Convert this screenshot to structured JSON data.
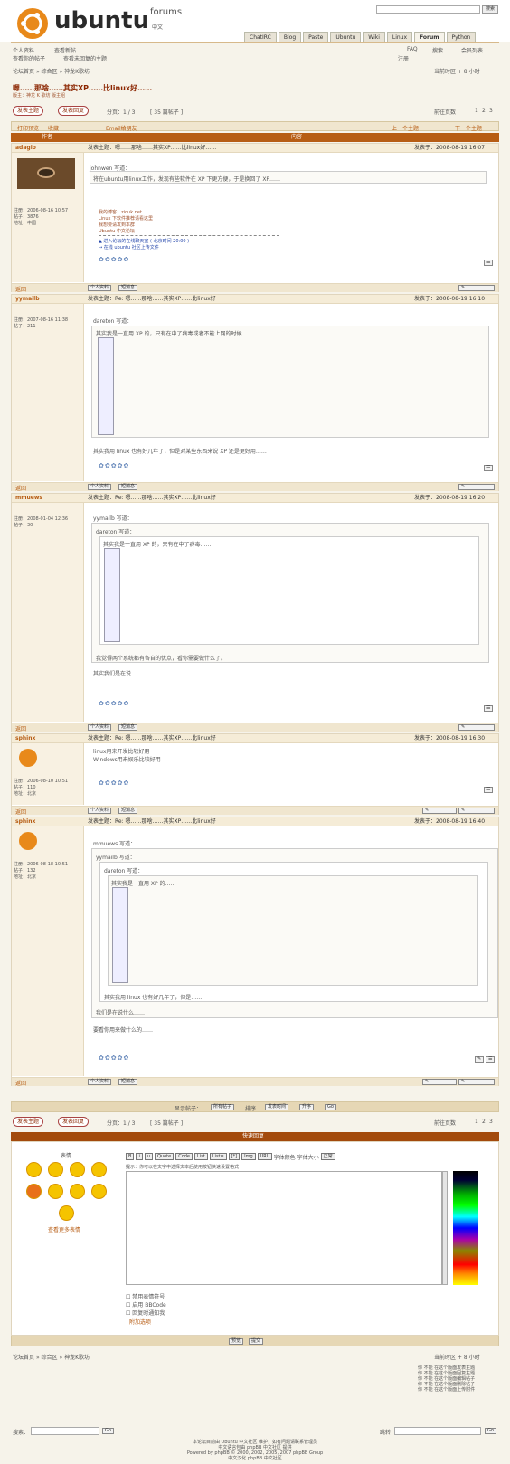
{
  "header": {
    "brand": "ubuntu",
    "forums": "forums",
    "lang": "中文",
    "search_btn": "搜索",
    "tabs": [
      "ChatIRC",
      "Blog",
      "Paste",
      "Ubuntu",
      "Wiki",
      "Linux",
      "Forum",
      "Python"
    ]
  },
  "userbar": {
    "faq": "FAQ",
    "search": "搜索",
    "members": "会员列表",
    "register": "注册",
    "profile": "个人资料",
    "pm": "查看新帖",
    "my_posts": "查看你的帖子",
    "unanswered": "查看未回复的主题"
  },
  "breadcrumb": {
    "home": "论坛首页",
    "sep1": "»",
    "area": "综合区",
    "sep2": "»",
    "forum": "神龙K歌坊",
    "time": "当前时区 + 8 小时"
  },
  "topic": {
    "title": "嗯……那啥……其实XP……比linux好……",
    "subtitle": "版主：神龙 K 歌坊 版主组"
  },
  "actions": {
    "new_topic": "发表主题",
    "reply": "发表回复",
    "pages": "分页：1 / 3",
    "posts": "[ 35 篇帖子 ]",
    "goto": "前往页数",
    "page1": "1",
    "page2": "2",
    "page3": "3"
  },
  "topicnav": {
    "print": "打印预览",
    "bookmark": "收藏",
    "email": "Email给朋友",
    "prev": "上一个主题",
    "next": "下一个主题"
  },
  "table_head": {
    "author": "作者",
    "content": "内容"
  },
  "posts": [
    {
      "author": "adagio",
      "meta_left": "注册：2006-08-16 10:57",
      "meta_left2": "帖子：3876",
      "meta_left3": "地址：中国",
      "subject": "发表主题：嗯……那啥……其实XP……比linux好……",
      "time": "发表于：2008-08-19 16:07",
      "body1": "johnwen 写道：",
      "body2": "将在ubuntu用linux工作，发现有些软件在 XP 下更方便，于是换回了 XP……",
      "sig1": "我的博客：ziouk.net",
      "sig2": "Linux 下软件推荐请看这里",
      "sig3": "我想要请发到本群",
      "sig4": "Ubuntu 中文论坛",
      "link1": "▲ 进入论坛的在线聊天室 ( 北京时间 20:00 )",
      "link2": "→ 在线 ubuntu 社区上传文件",
      "footer_l": "返回",
      "prof": "个人资料",
      "pm": "短消息"
    },
    {
      "author": "yymailb",
      "meta_left": "注册：2007-08-16 11:38",
      "meta_left2": "帖子：211",
      "subject": "发表主题：Re: 嗯……那啥……其实XP……比linux好",
      "time": "发表于：2008-08-19 16:10",
      "quote": "dareton 写道：",
      "quote2": "其实我是一直用 XP 的，只有在中了病毒或者不能上网的时候……",
      "body": "其实我用 linux 也有好几年了，但是对某些东西来说 XP 还是更好用……",
      "footer_l": "返回",
      "prof": "个人资料",
      "pm": "短消息"
    },
    {
      "author": "mmuews",
      "meta_left": "注册：2008-01-04 12:36",
      "meta_left2": "帖子：30",
      "subject": "发表主题：Re: 嗯……那啥……其实XP……比linux好",
      "time": "发表于：2008-08-19 16:20",
      "quote": "yymailb 写道：",
      "quote_inner": "dareton 写道：",
      "quote_inner2": "其实我是一直用 XP 的，只有在中了病毒……",
      "quote_tail": "我觉得两个系统都有各自的优点，看你需要做什么了。",
      "body": "其实我们是在说……",
      "footer_l": "返回",
      "prof": "个人资料",
      "pm": "短消息"
    },
    {
      "author": "sphinx",
      "meta_left": "注册：2006-08-10 10:51",
      "meta_left2": "帖子：110",
      "meta_left3": "地址：北京",
      "subject": "发表主题：Re: 嗯……那啥……其实XP……比linux好",
      "time": "发表于：2008-08-19 16:30",
      "body": "linux用来开发比较好用\nWindows用来娱乐比较好用",
      "footer_l": "返回",
      "prof": "个人资料",
      "pm": "短消息"
    },
    {
      "author": "sphinx",
      "meta_left": "注册：2006-08-18 10:51",
      "meta_left2": "帖子：132",
      "meta_left3": "地址：北京",
      "subject": "发表主题：Re: 嗯……那啥……其实XP……比linux好",
      "time": "发表于：2008-08-19 16:40",
      "quote": "mmuews 写道：",
      "quote2": "yymailb 写道：",
      "quote3": "dareton 写道：",
      "quote4": "其实我是一直用 XP 的……",
      "quote_tail": "其实我用 linux 也有好几年了，但是……",
      "quote_end": "我们是在说什么……",
      "body": "要看你用来做什么的……",
      "footer_l": "返回",
      "prof": "个人资料",
      "pm": "短消息"
    }
  ],
  "sort": {
    "label": "显示帖子：",
    "opt1": "所有帖子",
    "label2": "排序",
    "opt2": "发表时间",
    "opt3": "升序",
    "go": "Go"
  },
  "qr": {
    "title": "快速回复",
    "smilies": "表情",
    "more": "查看更多表情",
    "font_label": "字体大小",
    "font_val": "正常",
    "hint": "提示：你可以在文字中选择文本后使用按钮快速设置格式",
    "opt1": "禁用表情符号",
    "opt2": "启用 BBCode",
    "opt3": "回复时通知我",
    "more_opts": "附加选项",
    "submit": "提交",
    "preview": "预览",
    "fmt": [
      "B",
      "i",
      "u",
      "Quote",
      "Code",
      "List",
      "List=",
      "[*]",
      "Img",
      "URL",
      "字体颜色"
    ]
  },
  "bottom": {
    "jump_label": "跳转：",
    "jump_go": "Go",
    "search_label": "搜索：",
    "search_go": "Go",
    "rights": [
      "你 不能 在这个版面发表主题",
      "你 不能 在这个版面回复主题",
      "你 不能 在这个版面编辑帖子",
      "你 不能 在这个版面删除帖子",
      "你 不能 在这个版面上传附件"
    ],
    "footer1": "本论坛目前由 Ubuntu 中文社区 维护，如有问题请联系管理员",
    "footer2": "中文语言包由 phpBB 中文社区 提供",
    "powered": "Powered by phpBB © 2000, 2002, 2005, 2007 phpBB Group",
    "footer3": "中文汉化 phpBB 中文社区"
  },
  "colors": {
    "accent": "#b75d14",
    "title": "#8b2500"
  }
}
